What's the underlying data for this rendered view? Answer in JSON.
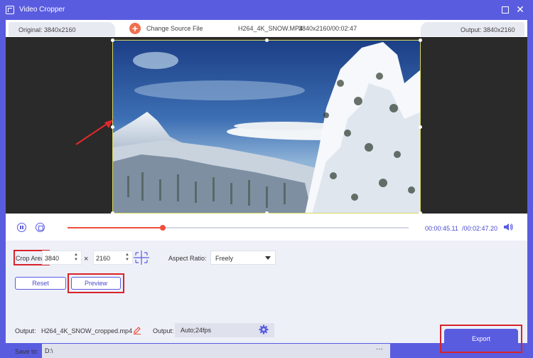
{
  "window": {
    "title": "Video Cropper"
  },
  "infobar": {
    "original": "Original: 3840x2160",
    "change_source": "Change Source File",
    "file_name": "H264_4K_SNOW.MP4",
    "file_meta": "3840x2160/00:02:47",
    "output_resolution": "Output: 3840x2160"
  },
  "playback": {
    "progress_fraction": 0.28,
    "time_current": "00:00:45.11",
    "time_total": "/00:02:47.20"
  },
  "crop": {
    "label": "Crop Area:",
    "width": "3840",
    "times": "×",
    "height": "2160",
    "aspect_label": "Aspect Ratio:",
    "aspect_value": "Freely",
    "reset_label": "Reset",
    "preview_label": "Preview"
  },
  "output": {
    "output_label": "Output:",
    "output_file": "H264_4K_SNOW_cropped.mp4",
    "format_label": "Output:",
    "format_value": "Auto;24fps",
    "save_label": "Save to:",
    "save_path": "D:\\",
    "more_label": "···",
    "export_label": "Export"
  },
  "colors": {
    "accent": "#5a5ce0",
    "progress": "#f04e3a",
    "highlight": "#d8232a"
  }
}
